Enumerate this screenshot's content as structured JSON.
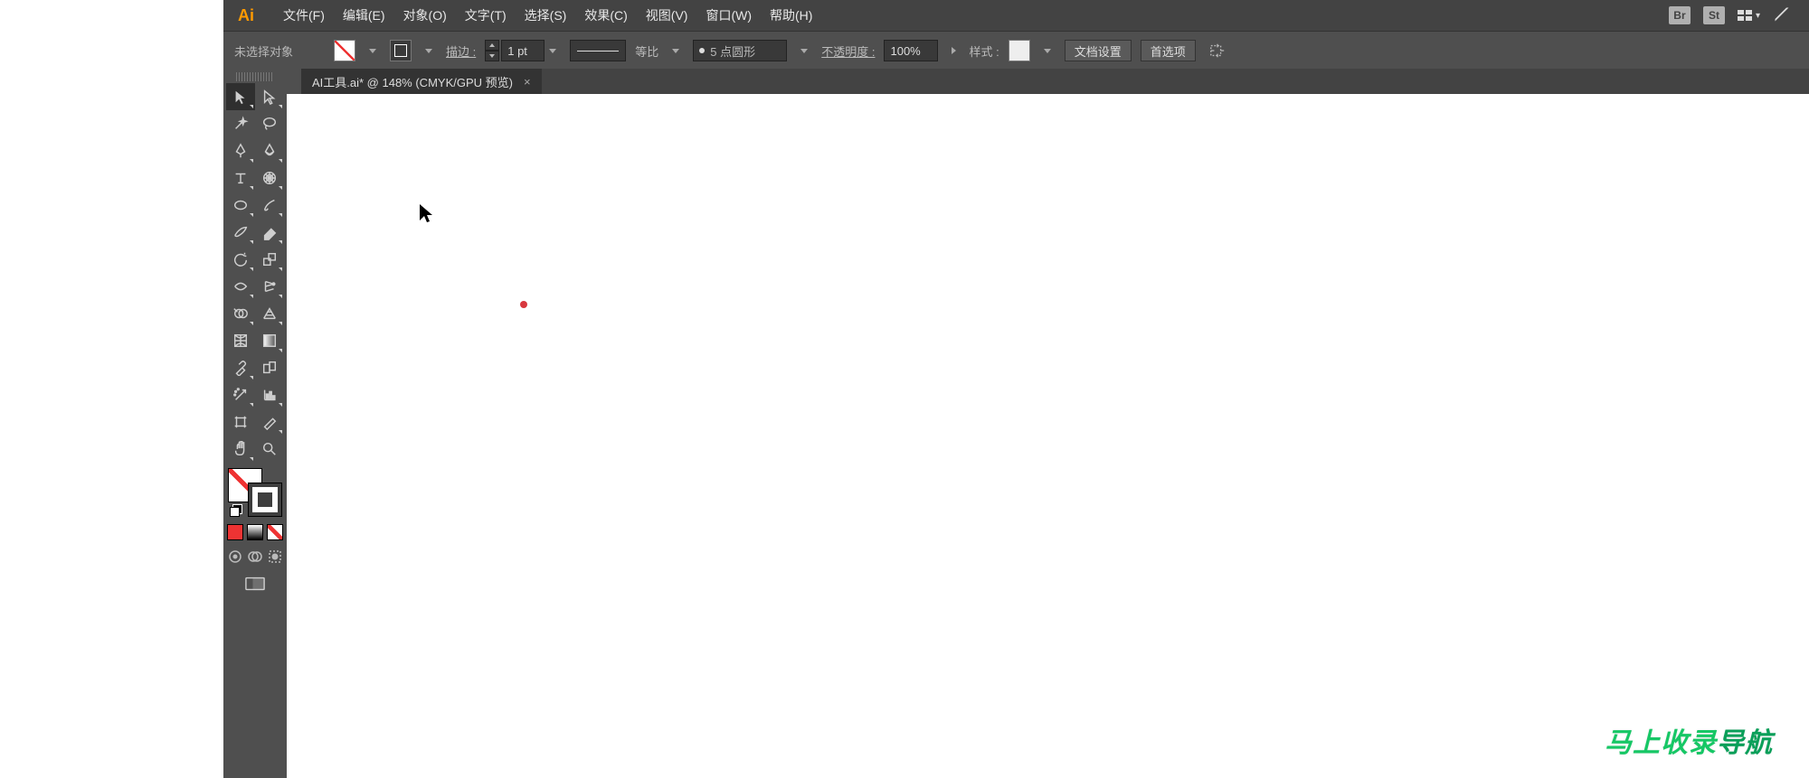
{
  "menu": {
    "logo": "Ai",
    "items": [
      "文件(F)",
      "编辑(E)",
      "对象(O)",
      "文字(T)",
      "选择(S)",
      "效果(C)",
      "视图(V)",
      "窗口(W)",
      "帮助(H)"
    ],
    "badge_br": "Br",
    "badge_st": "St"
  },
  "left_strip": {
    "chevrons": "‹‹"
  },
  "control": {
    "selection_status": "未选择对象",
    "stroke_label": "描边 :",
    "stroke_weight": "1 pt",
    "profile_label": "等比",
    "brush_label": "5 点圆形",
    "opacity_label": "不透明度 :",
    "opacity_value": "100%",
    "style_label": "样式 :",
    "btn_doc_setup": "文档设置",
    "btn_prefs": "首选项"
  },
  "tab": {
    "title": "AI工具.ai* @ 148% (CMYK/GPU 预览)",
    "close": "×"
  },
  "tools": {
    "names": [
      "selection-tool",
      "direct-selection-tool",
      "magic-wand-tool",
      "lasso-tool",
      "pen-tool",
      "curvature-tool",
      "type-tool",
      "polar-grid-tool",
      "ellipse-tool",
      "paintbrush-tool",
      "blob-brush-tool",
      "eraser-tool",
      "rotate-tool",
      "scale-tool",
      "width-tool",
      "puppet-warp-tool",
      "shape-builder-tool",
      "perspective-grid-tool",
      "mesh-tool",
      "gradient-tool",
      "eyedropper-tool",
      "blend-tool",
      "symbol-sprayer-tool",
      "column-graph-tool",
      "artboard-tool",
      "slice-tool",
      "hand-tool",
      "zoom-tool"
    ]
  },
  "watermark": {
    "a": "马上收录",
    "b": "导航"
  }
}
